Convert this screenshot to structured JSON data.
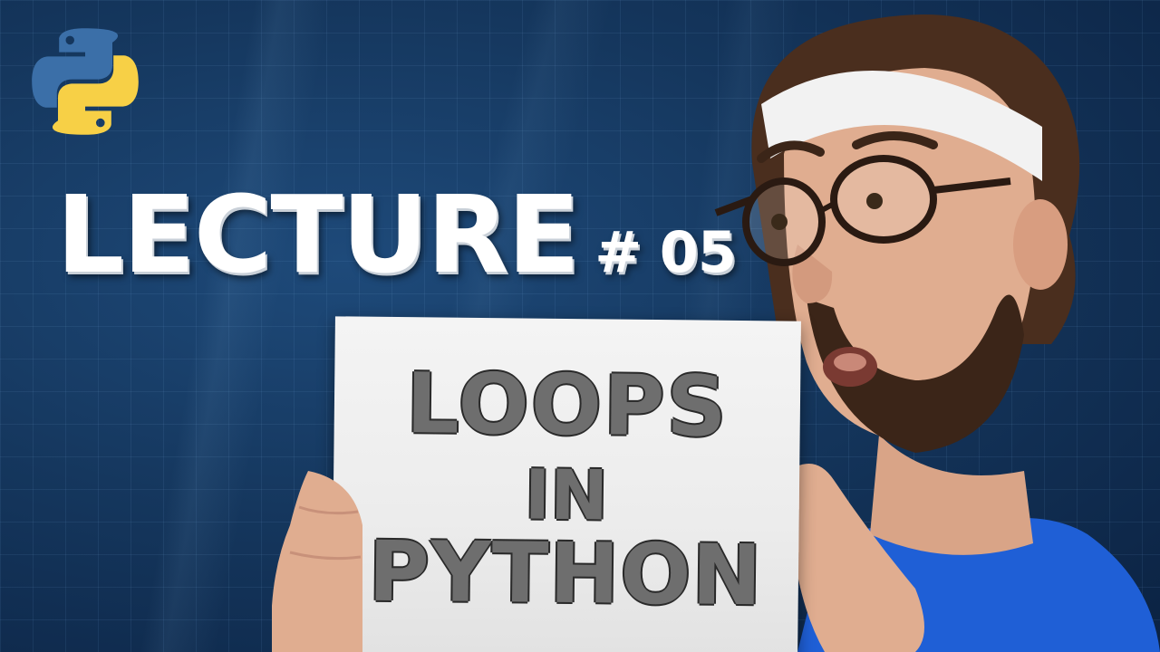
{
  "title": {
    "main": "LECTURE",
    "number": "# 05"
  },
  "sign": {
    "line1": "LOOPS",
    "line2": "IN",
    "line3": "PYTHON"
  },
  "logo": {
    "icon": "python-logo-icon",
    "colors": [
      "#3b6fa8",
      "#f7d046"
    ]
  },
  "colors": {
    "background": "#15375e",
    "title_text": "#ffffff",
    "sign_text": "#6e6e6e",
    "shirt": "#1f5fd6"
  }
}
